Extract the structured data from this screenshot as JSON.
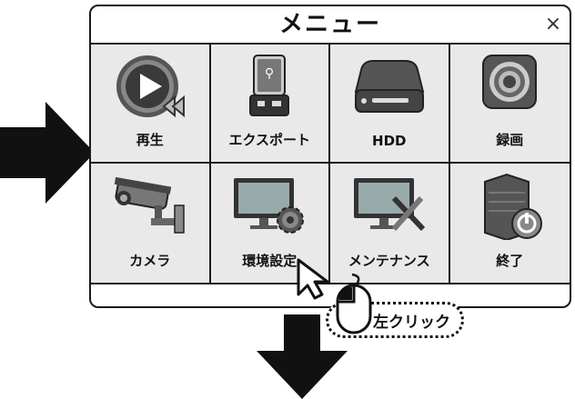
{
  "menu": {
    "title": "メニュー",
    "close_symbol": "×",
    "items": [
      {
        "label": "再生",
        "icon": "play-icon"
      },
      {
        "label": "エクスポート",
        "icon": "usb-drive-icon"
      },
      {
        "label": "HDD",
        "icon": "hdd-icon"
      },
      {
        "label": "録画",
        "icon": "record-icon"
      },
      {
        "label": "カメラ",
        "icon": "security-camera-icon"
      },
      {
        "label": "環境設定",
        "icon": "settings-monitor-icon"
      },
      {
        "label": "メンテナンス",
        "icon": "maintenance-monitor-icon"
      },
      {
        "label": "終了",
        "icon": "shutdown-server-icon"
      }
    ]
  },
  "annotation": {
    "left_click_label": "左クリック"
  }
}
